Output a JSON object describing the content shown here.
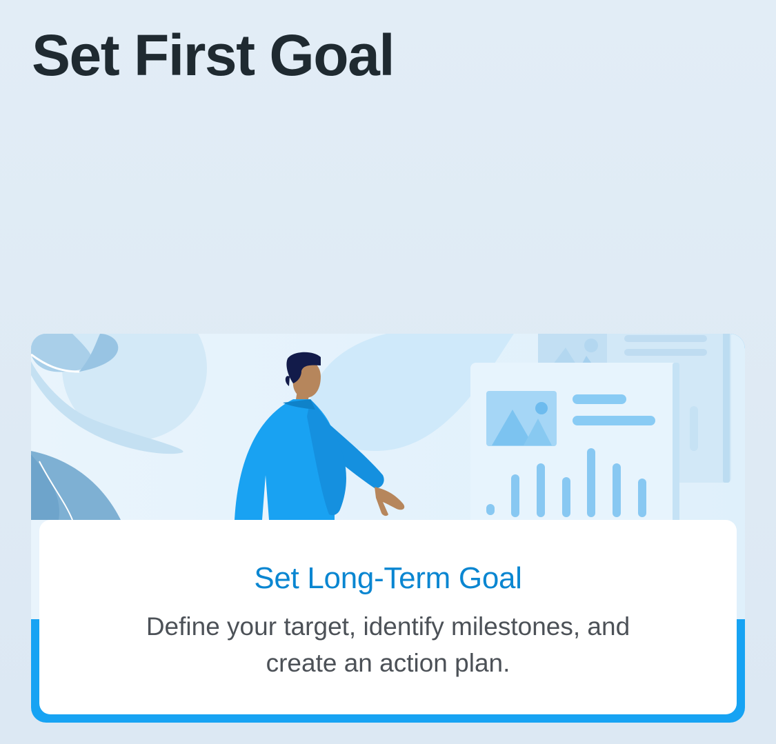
{
  "header": {
    "title": "Set First Goal"
  },
  "card": {
    "title": "Set Long-Term Goal",
    "description": "Define your target, identify milestones, and create an action plan."
  },
  "colors": {
    "background": "#e0ecf5",
    "accent": "#17a3f3",
    "title_text": "#1f2a31",
    "card_title": "#0a86d1",
    "card_description": "#4c5157"
  },
  "illustration": {
    "subject": "person-pointing-at-dashboard",
    "elements": [
      "person-illustration",
      "dashboard-screen-illustration",
      "bar-chart-icon",
      "image-placeholder-icon",
      "leaf-decoration"
    ]
  }
}
